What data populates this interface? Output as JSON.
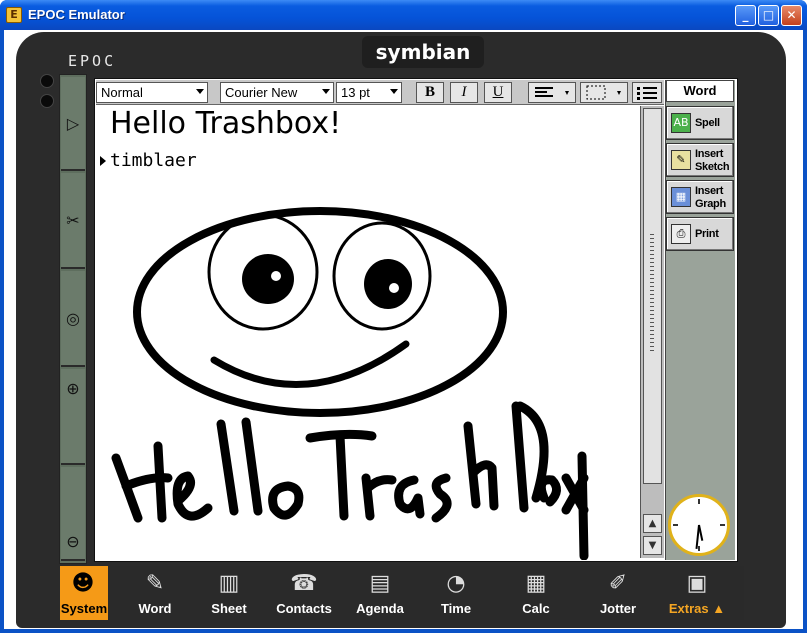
{
  "window": {
    "title": "EPOC Emulator",
    "icon": "epoc-app-icon",
    "controls": {
      "minimize": "_",
      "maximize": "□",
      "close": "✕"
    }
  },
  "device": {
    "brand_label": "EPOC",
    "logo_text": "symbian"
  },
  "side_buttons": [
    {
      "name": "menu-icon",
      "glyph": "▷"
    },
    {
      "name": "clipboard-icon",
      "glyph": "✂"
    },
    {
      "name": "infrared-icon",
      "glyph": "◎"
    },
    {
      "name": "zoom-in-icon",
      "glyph": "⊕"
    },
    {
      "name": "zoom-out-icon",
      "glyph": "⊖"
    }
  ],
  "toolbar": {
    "style": "Normal",
    "font": "Courier New",
    "size": "13 pt",
    "bold": "B",
    "italic": "I",
    "underline": "U"
  },
  "document": {
    "heading": "Hello Trashbox!",
    "line": "timblaer",
    "handwriting": "HelloTrashbox"
  },
  "app": {
    "title": "Word",
    "commands": [
      {
        "label": "Spell",
        "icon": "spell-check-icon",
        "glyph": "AB"
      },
      {
        "label": "Insert Sketch",
        "icon": "insert-sketch-icon",
        "glyph": "✎"
      },
      {
        "label": "Insert Graph",
        "icon": "insert-graph-icon",
        "glyph": "▦"
      },
      {
        "label": "Print",
        "icon": "printer-icon",
        "glyph": "⎙"
      }
    ]
  },
  "taskbar": [
    {
      "label": "System",
      "glyph": "☻",
      "active": true
    },
    {
      "label": "Word",
      "glyph": "✎"
    },
    {
      "label": "Sheet",
      "glyph": "▥"
    },
    {
      "label": "Contacts",
      "glyph": "☎"
    },
    {
      "label": "Agenda",
      "glyph": "▤"
    },
    {
      "label": "Time",
      "glyph": "◔"
    },
    {
      "label": "Calc",
      "glyph": "▦"
    },
    {
      "label": "Jotter",
      "glyph": "✐"
    },
    {
      "label": "Extras ▲",
      "glyph": "▣"
    }
  ],
  "colors": {
    "title_bar": "#0553d8",
    "active_task": "#f59a17",
    "extras_label": "#f5a623",
    "clock_rim": "#e0b21a"
  }
}
